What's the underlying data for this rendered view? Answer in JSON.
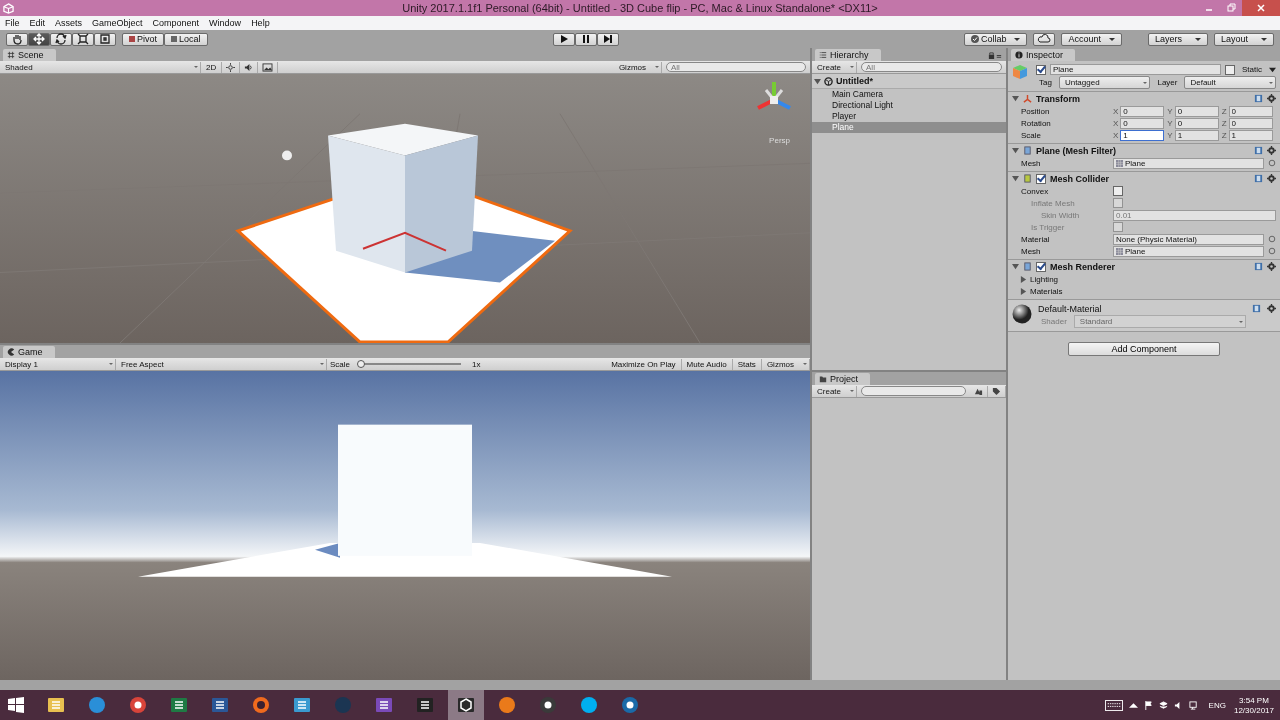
{
  "window": {
    "title": "Unity 2017.1.1f1 Personal (64bit) - Untitled - 3D Cube flip - PC, Mac & Linux Standalone* <DX11>"
  },
  "menu": [
    "File",
    "Edit",
    "Assets",
    "GameObject",
    "Component",
    "Window",
    "Help"
  ],
  "toolbar": {
    "tools": [
      {
        "kind": "hand",
        "selected": false
      },
      {
        "kind": "move",
        "selected": true
      },
      {
        "kind": "rotate",
        "selected": false
      },
      {
        "kind": "scale",
        "selected": false
      },
      {
        "kind": "rect",
        "selected": false
      }
    ],
    "pivot": "Pivot",
    "local": "Local",
    "playing": false,
    "paused": false,
    "collab": "Collab",
    "account": "Account",
    "layers": "Layers",
    "layout": "Layout"
  },
  "scene": {
    "tab": "Scene",
    "shading": "Shaded",
    "mode_2d": "2D",
    "gizmos": "Gizmos",
    "search_placeholder": "All",
    "view_label": "Persp"
  },
  "game": {
    "tab": "Game",
    "display": "Display 1",
    "aspect": "Free Aspect",
    "scale_label": "Scale",
    "level": 0,
    "scale_value": "1x",
    "toggles": [
      {
        "label": "Maximize On Play",
        "on": false
      },
      {
        "label": "Mute Audio",
        "on": false
      },
      {
        "label": "Stats",
        "on": false
      }
    ],
    "gizmos": "Gizmos"
  },
  "hierarchy": {
    "tab": "Hierarchy",
    "create": "Create",
    "search_placeholder": "All",
    "scene": "Untitled*",
    "items": [
      {
        "label": "Main Camera",
        "selected": false
      },
      {
        "label": "Directional Light",
        "selected": false
      },
      {
        "label": "Player",
        "selected": false
      },
      {
        "label": "Plane",
        "selected": true
      }
    ]
  },
  "project": {
    "tab": "Project",
    "create": "Create"
  },
  "inspector": {
    "tab": "Inspector",
    "object": {
      "active": true,
      "name": "Plane",
      "static_label": "Static",
      "static": false,
      "tag_label": "Tag",
      "tag": "Untagged",
      "layer_label": "Layer",
      "layer": "Default"
    },
    "components": [
      {
        "kind": "transform",
        "title": "Transform",
        "expanded": true,
        "rows": [
          {
            "kind": "vector",
            "label": "Position",
            "values": [
              {
                "axis": "X",
                "value": "0",
                "focused": false
              },
              {
                "axis": "Y",
                "value": "0",
                "focused": false
              },
              {
                "axis": "Z",
                "value": "0",
                "focused": false
              }
            ]
          },
          {
            "kind": "vector",
            "label": "Rotation",
            "values": [
              {
                "axis": "X",
                "value": "0",
                "focused": false
              },
              {
                "axis": "Y",
                "value": "0",
                "focused": false
              },
              {
                "axis": "Z",
                "value": "0",
                "focused": false
              }
            ]
          },
          {
            "kind": "vector",
            "label": "Scale",
            "values": [
              {
                "axis": "X",
                "value": "1",
                "focused": true
              },
              {
                "axis": "Y",
                "value": "1",
                "focused": false
              },
              {
                "axis": "Z",
                "value": "1",
                "focused": false
              }
            ]
          }
        ]
      },
      {
        "kind": "mesh_filter",
        "title": "Plane (Mesh Filter)",
        "expanded": true,
        "rows": [
          {
            "kind": "asset",
            "label": "Mesh",
            "value": "Plane"
          }
        ]
      },
      {
        "kind": "mesh_collider",
        "title": "Mesh Collider",
        "expanded": true,
        "enabled": true,
        "rows": [
          {
            "kind": "checkbox",
            "label": "Convex",
            "checked": false,
            "disabled": false,
            "children": [
              {
                "kind": "checkbox",
                "label": "Inflate Mesh",
                "checked": false,
                "disabled": true,
                "children": [
                  {
                    "kind": "number",
                    "label": "Skin Width",
                    "value": "0.01",
                    "disabled": true
                  }
                ]
              },
              {
                "kind": "checkbox",
                "label": "Is Trigger",
                "checked": false,
                "disabled": true
              }
            ]
          },
          {
            "kind": "object",
            "label": "Material",
            "value": "None (Physic Material)"
          },
          {
            "kind": "asset",
            "label": "Mesh",
            "value": "Plane"
          }
        ]
      },
      {
        "kind": "mesh_renderer",
        "title": "Mesh Renderer",
        "expanded": true,
        "enabled": true,
        "rows": [
          {
            "kind": "foldout",
            "label": "Lighting",
            "expanded": false
          },
          {
            "kind": "foldout",
            "label": "Materials",
            "expanded": false
          }
        ]
      }
    ],
    "material": {
      "name": "Default-Material",
      "shader_label": "Shader",
      "shader": "Standard"
    },
    "add_component": "Add Component"
  },
  "taskbar": {
    "apps": [
      {
        "kind": "folder",
        "selected": false
      },
      {
        "kind": "ie",
        "selected": false
      },
      {
        "kind": "chrome",
        "selected": false
      },
      {
        "kind": "excel",
        "selected": false
      },
      {
        "kind": "word",
        "selected": false
      },
      {
        "kind": "ring",
        "selected": false
      },
      {
        "kind": "film",
        "selected": false
      },
      {
        "kind": "steam",
        "selected": false
      },
      {
        "kind": "studio",
        "selected": false
      },
      {
        "kind": "shield",
        "selected": false
      },
      {
        "kind": "unity",
        "selected": true
      },
      {
        "kind": "blender",
        "selected": false
      },
      {
        "kind": "obs",
        "selected": false
      },
      {
        "kind": "skype",
        "selected": false
      },
      {
        "kind": "globe",
        "selected": false
      }
    ],
    "language": "ENG",
    "time": "3:54 PM",
    "date": "12/30/2017"
  }
}
